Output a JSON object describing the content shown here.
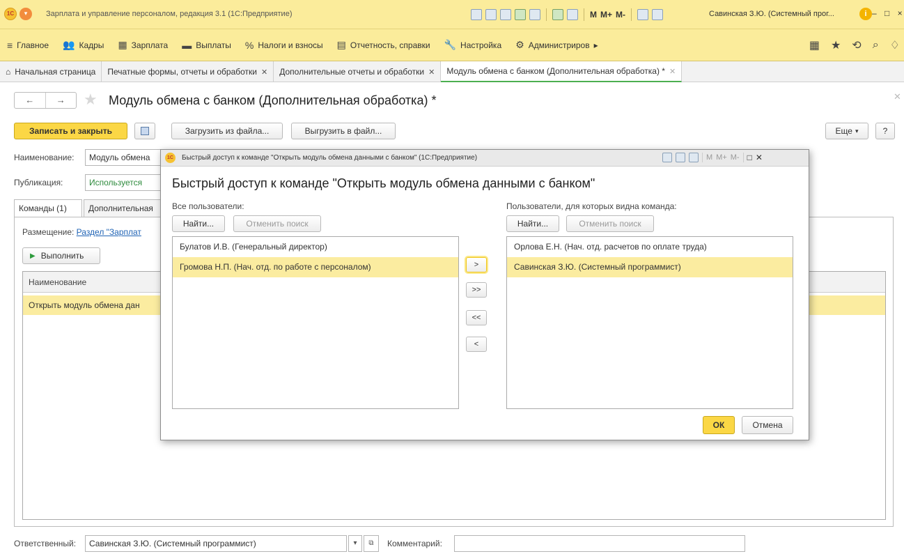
{
  "titlebar": {
    "app_title": "Зарплата и управление персоналом, редакция 3.1  (1С:Предприятие)",
    "m_label": "M",
    "mplus_label": "M+",
    "mminus_label": "M-",
    "user": "Савинская З.Ю. (Системный прог...",
    "window_controls": "– □ ×"
  },
  "main_menu": {
    "items": [
      {
        "label": "Главное",
        "icon": "hamburger-icon"
      },
      {
        "label": "Кадры",
        "icon": "people-icon"
      },
      {
        "label": "Зарплата",
        "icon": "calculator-icon"
      },
      {
        "label": "Выплаты",
        "icon": "money-icon"
      },
      {
        "label": "Налоги и взносы",
        "icon": "percent-icon"
      },
      {
        "label": "Отчетность, справки",
        "icon": "report-icon"
      },
      {
        "label": "Настройка",
        "icon": "wrench-icon"
      },
      {
        "label": "Администриров",
        "icon": "gear-icon"
      }
    ]
  },
  "tabs": [
    {
      "label": "Начальная страница",
      "closable": false
    },
    {
      "label": "Печатные формы, отчеты и обработки",
      "closable": true
    },
    {
      "label": "Дополнительные отчеты и обработки",
      "closable": true
    },
    {
      "label": "Модуль обмена с банком (Дополнительная обработка) *",
      "closable": true,
      "active": true
    }
  ],
  "form": {
    "title": "Модуль обмена с банком (Дополнительная обработка) *",
    "save_close": "Записать и закрыть",
    "load_file": "Загрузить из файла...",
    "export_file": "Выгрузить в файл...",
    "more": "Еще",
    "help": "?",
    "name_label": "Наименование:",
    "name_value": "Модуль обмена",
    "publication_label": "Публикация:",
    "publication_value": "Используется",
    "tab_commands": "Команды (1)",
    "tab_additional": "Дополнительная",
    "placement_label": "Размещение:",
    "placement_link": "Раздел \"Зарплат",
    "run": "Выполнить",
    "grid_header": "Наименование",
    "grid_row": "Открыть модуль обмена дан",
    "responsible_label": "Ответственный:",
    "responsible_value": "Савинская З.Ю. (Системный программист)",
    "comment_label": "Комментарий:",
    "comment_value": ""
  },
  "dialog": {
    "window_title": "Быстрый доступ к команде \"Открыть модуль обмена данными с банком\"  (1С:Предприятие)",
    "heading": "Быстрый доступ к команде \"Открыть модуль обмена данными с банком\"",
    "all_users_label": "Все пользователи:",
    "visible_users_label": "Пользователи, для которых видна команда:",
    "find": "Найти...",
    "cancel_search": "Отменить поиск",
    "all_users": [
      {
        "name": "Булатов И.В. (Генеральный директор)",
        "selected": false
      },
      {
        "name": "Громова Н.П. (Нач. отд. по работе с персоналом)",
        "selected": true
      }
    ],
    "visible_users": [
      {
        "name": "Орлова Е.Н. (Нач. отд. расчетов по оплате труда)",
        "selected": false
      },
      {
        "name": "Савинская З.Ю. (Системный программист)",
        "selected": true
      }
    ],
    "move_right": ">",
    "move_all_right": ">>",
    "move_all_left": "<<",
    "move_left": "<",
    "ok": "ОК",
    "cancel": "Отмена",
    "m_label": "M",
    "mplus_label": "M+",
    "mminus_label": "M-"
  }
}
